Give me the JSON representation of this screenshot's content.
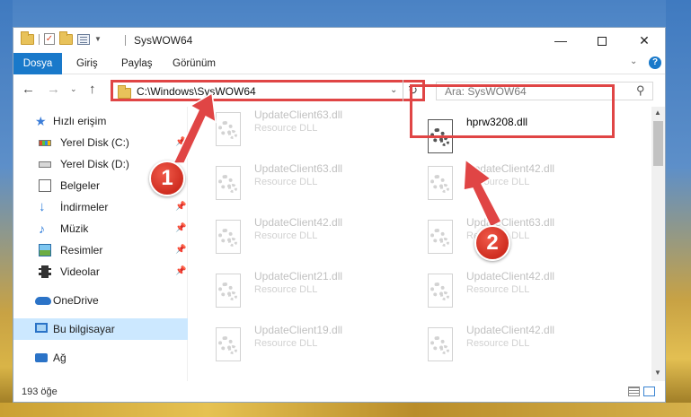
{
  "window": {
    "title": "SysWOW64",
    "minimize": "—",
    "close": "✕"
  },
  "ribbon": {
    "tabs": [
      "Dosya",
      "Giriş",
      "Paylaş",
      "Görünüm"
    ]
  },
  "address": {
    "path": "C:\\Windows\\SysWOW64",
    "search_placeholder": "Ara: SysWOW64"
  },
  "sidebar": {
    "items": [
      {
        "label": "Hızlı erişim",
        "icon": "star-icon"
      },
      {
        "label": "Yerel Disk (C:)",
        "icon": "drive-icon",
        "pinned": true
      },
      {
        "label": "Yerel Disk (D:)",
        "icon": "drive-icon"
      },
      {
        "label": "Belgeler",
        "icon": "documents-icon"
      },
      {
        "label": "İndirmeler",
        "icon": "downloads-icon",
        "pinned": true
      },
      {
        "label": "Müzik",
        "icon": "music-icon",
        "pinned": true
      },
      {
        "label": "Resimler",
        "icon": "pictures-icon",
        "pinned": true
      },
      {
        "label": "Videolar",
        "icon": "videos-icon",
        "pinned": true
      },
      {
        "label": "OneDrive",
        "icon": "onedrive-icon"
      },
      {
        "label": "Bu bilgisayar",
        "icon": "this-pc-icon",
        "selected": true
      },
      {
        "label": "Ağ",
        "icon": "network-icon"
      }
    ]
  },
  "files": [
    {
      "name": "UpdateClient63.dll",
      "type": "Resource DLL"
    },
    {
      "name": "hprw3208.dll",
      "type": "",
      "highlighted": true
    },
    {
      "name": "UpdateClient63.dll",
      "type": "Resource DLL"
    },
    {
      "name": "UpdateClient42.dll",
      "type": "Resource DLL"
    },
    {
      "name": "UpdateClient42.dll",
      "type": "Resource DLL"
    },
    {
      "name": "UpdateClient63.dll",
      "type": "Resource DLL"
    },
    {
      "name": "UpdateClient21.dll",
      "type": "Resource DLL"
    },
    {
      "name": "UpdateClient42.dll",
      "type": "Resource DLL"
    },
    {
      "name": "UpdateClient19.dll",
      "type": "Resource DLL"
    },
    {
      "name": "UpdateClient42.dll",
      "type": "Resource DLL"
    }
  ],
  "status": {
    "item_count": "193 öğe"
  },
  "callouts": [
    "1",
    "2"
  ],
  "colors": {
    "accent": "#1979ca",
    "highlight": "#e04545",
    "selected": "#cce8ff"
  }
}
